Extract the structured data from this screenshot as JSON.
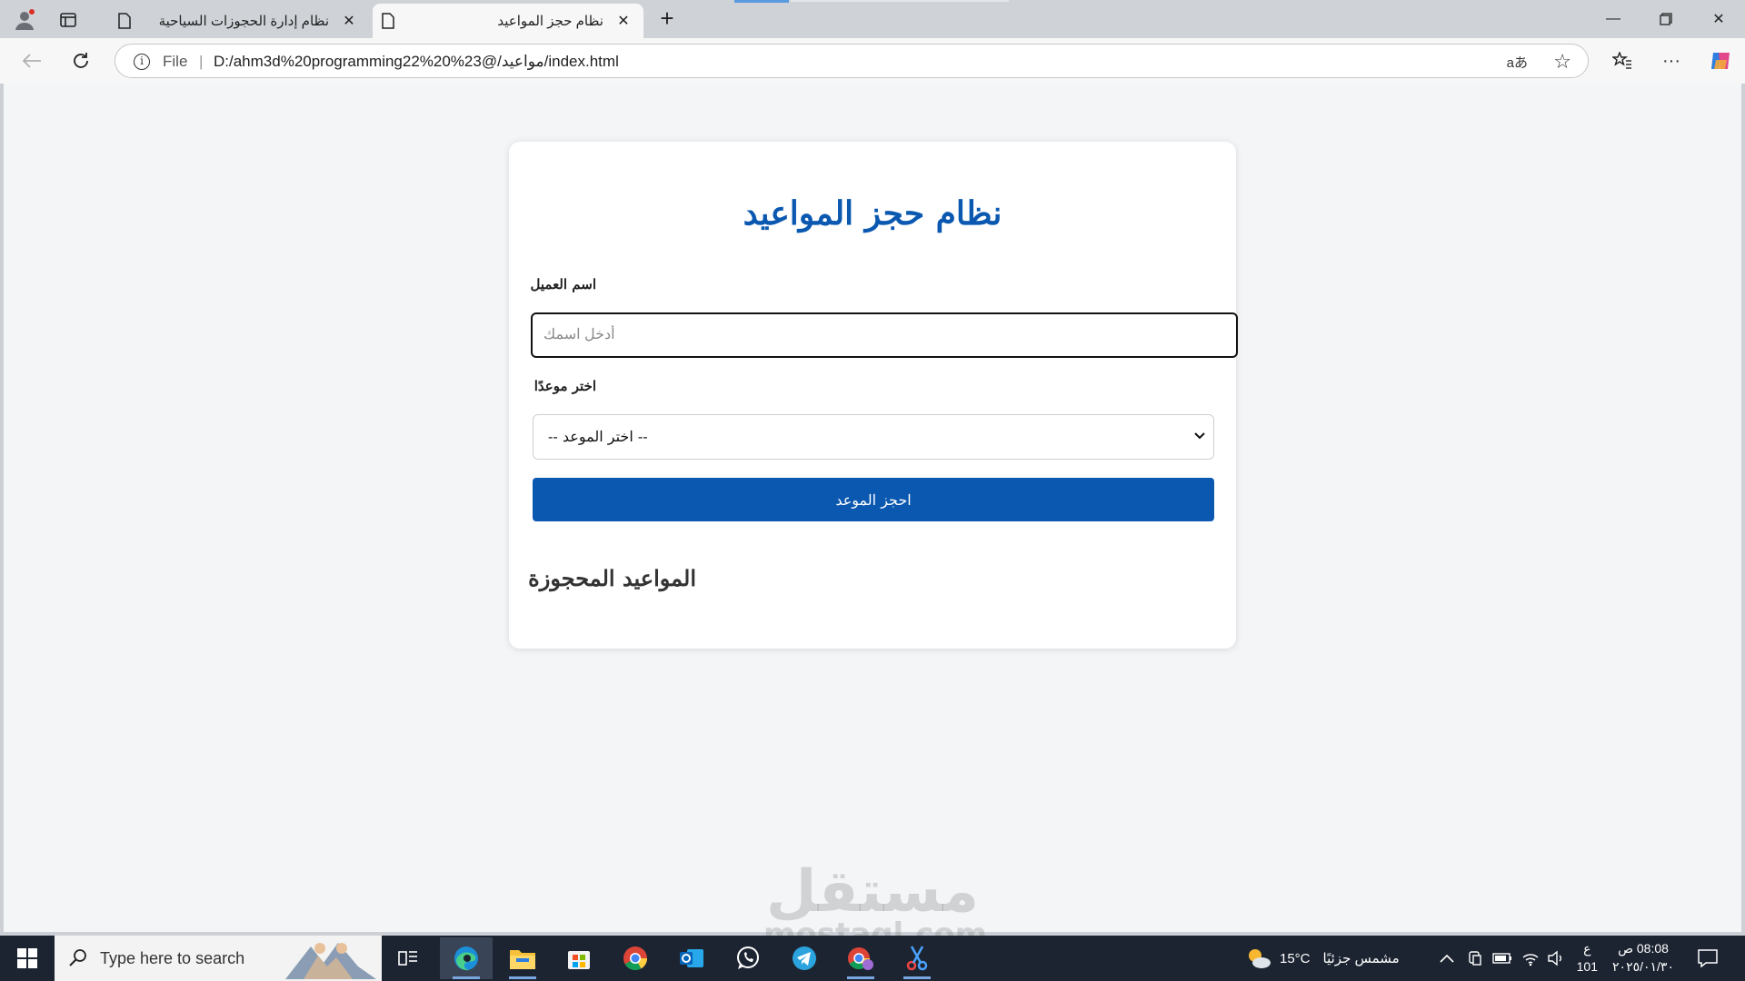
{
  "browser": {
    "tabs": [
      {
        "title": "نظام إدارة الحجوزات السياحية",
        "active": false
      },
      {
        "title": "نظام حجز المواعيد",
        "active": true
      }
    ],
    "address": {
      "scheme_label": "File",
      "url": "D:/ahm3d%20programming22%20%23@/مواعيد/index.html"
    },
    "icons": [
      "profile-icon",
      "workspaces-icon",
      "page-icon",
      "close-icon",
      "add-icon",
      "back-icon",
      "refresh-icon",
      "info-icon",
      "read-aloud-icon",
      "favorite-star-icon",
      "favorites-icon",
      "more-icon",
      "copilot-icon"
    ]
  },
  "page": {
    "title": "نظام حجز المواعيد",
    "name_label": "اسم العميل",
    "name_placeholder": "أدخل اسمك",
    "date_label": "اختر موعدًا",
    "date_selected": "-- اختر الموعد --",
    "book_button": "احجز الموعد",
    "booked_heading": "المواعيد المحجوزة"
  },
  "watermark": {
    "line1": "مستقل",
    "line2": "mostaql.com"
  },
  "taskbar": {
    "search_placeholder": "Type here to search",
    "weather_temp": "15°C",
    "weather_desc": "مشمس جزئيًا",
    "clock_time": "08:08 ص",
    "clock_date": "٢٠٢٥/٠١/٣٠",
    "lang_line1": "ع",
    "lang_line2": "101",
    "apps": [
      "task-view",
      "edge",
      "file-explorer",
      "microsoft-store",
      "chrome",
      "outlook",
      "whatsapp",
      "telegram",
      "chrome-profile",
      "snipping-tool"
    ]
  },
  "colors": {
    "accent": "#0b58b0",
    "taskbar": "#1c2431",
    "page_bg": "#f4f5f7"
  }
}
